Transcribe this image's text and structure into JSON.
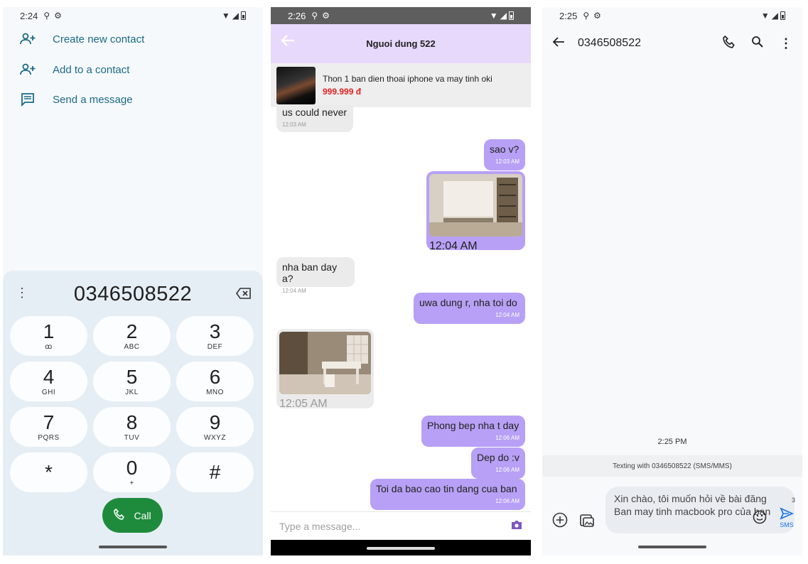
{
  "panel_dialer": {
    "status": {
      "time": "2:24"
    },
    "menu": [
      {
        "label": "Create new contact"
      },
      {
        "label": "Add to a contact"
      },
      {
        "label": "Send a message"
      }
    ],
    "display_number": "0346508522",
    "keys": [
      {
        "digit": "1",
        "letters": "ꝏ"
      },
      {
        "digit": "2",
        "letters": "ABC"
      },
      {
        "digit": "3",
        "letters": "DEF"
      },
      {
        "digit": "4",
        "letters": "GHI"
      },
      {
        "digit": "5",
        "letters": "JKL"
      },
      {
        "digit": "6",
        "letters": "MNO"
      },
      {
        "digit": "7",
        "letters": "PQRS"
      },
      {
        "digit": "8",
        "letters": "TUV"
      },
      {
        "digit": "9",
        "letters": "WXYZ"
      },
      {
        "digit": "*",
        "letters": ""
      },
      {
        "digit": "0",
        "letters": "+"
      },
      {
        "digit": "#",
        "letters": ""
      }
    ],
    "call_label": "Call",
    "colors": {
      "call": "#1e8b3c",
      "dialer_bg": "#e6eef5",
      "link": "#1b6a84"
    }
  },
  "panel_chat": {
    "status": {
      "time": "2:26"
    },
    "title": "Nguoi dung 522",
    "product": {
      "name": "Thon 1 ban dien thoai iphone va may tinh oki",
      "price": "999.999 đ"
    },
    "messages": [
      {
        "text": "us could never",
        "time": "12:03 AM",
        "from": "them"
      },
      {
        "text": "sao v?",
        "time": "12:03 AM",
        "from": "me"
      },
      {
        "text": "",
        "time": "12:04 AM",
        "from": "me",
        "image": "room-photo"
      },
      {
        "text": "nha ban day a?",
        "time": "12:04 AM",
        "from": "them"
      },
      {
        "text": "uwa dung r, nha toi do",
        "time": "12:04 AM",
        "from": "me"
      },
      {
        "text": "",
        "time": "12:05 AM",
        "from": "them",
        "image": "kitchen-photo"
      },
      {
        "text": "Phong bep nha t day",
        "time": "12:06 AM",
        "from": "me"
      },
      {
        "text": "Dep do :v",
        "time": "12:06 AM",
        "from": "me"
      },
      {
        "text": "Toi da bao cao tin dang cua ban",
        "time": "12:06 AM",
        "from": "me"
      }
    ],
    "input_placeholder": "Type a message...",
    "colors": {
      "header": "#e7d9fb",
      "sent": "#b7a0f5",
      "received": "#ebebeb",
      "price": "#e02020"
    }
  },
  "panel_sms": {
    "status": {
      "time": "2:25"
    },
    "number": "0346508522",
    "timestamp": "2:25 PM",
    "texting_with": "Texting with 0346508522 (SMS/MMS)",
    "draft": "Xin chào, tôi muốn hỏi về bài đăng Ban may tinh macbook pro của bạn",
    "char_count": "3",
    "send_label": "SMS",
    "colors": {
      "send": "#1a73e8"
    }
  }
}
